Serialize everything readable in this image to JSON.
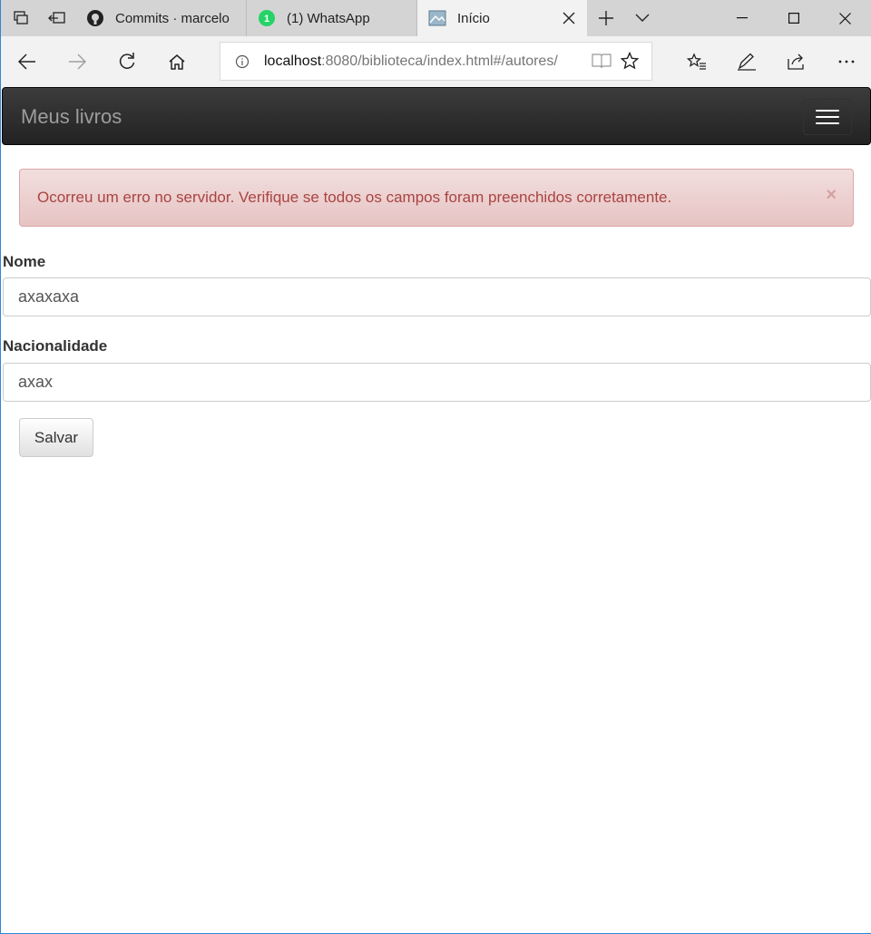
{
  "browser": {
    "tabs": [
      {
        "title": "Commits · marcelo",
        "icon": "github-icon"
      },
      {
        "title": "(1) WhatsApp",
        "icon": "whatsapp-icon",
        "badge": "1"
      },
      {
        "title": "Início",
        "icon": "page-icon",
        "active": true
      }
    ],
    "address": {
      "host": "localhost",
      "rest": ":8080/biblioteca/index.html#/autores/"
    }
  },
  "app": {
    "brand": "Meus livros",
    "alert": {
      "message": "Ocorreu um erro no servidor. Verifique se todos os campos foram preenchidos corretamente.",
      "close": "×"
    },
    "form": {
      "nome_label": "Nome",
      "nome_value": "axaxaxa",
      "nacionalidade_label": "Nacionalidade",
      "nacionalidade_value": "axax",
      "save_label": "Salvar"
    }
  },
  "colors": {
    "alert_text": "#a94442",
    "alert_bg": "#f2dede",
    "navbar_bg": "#222222",
    "accent": "#2b88d8"
  }
}
